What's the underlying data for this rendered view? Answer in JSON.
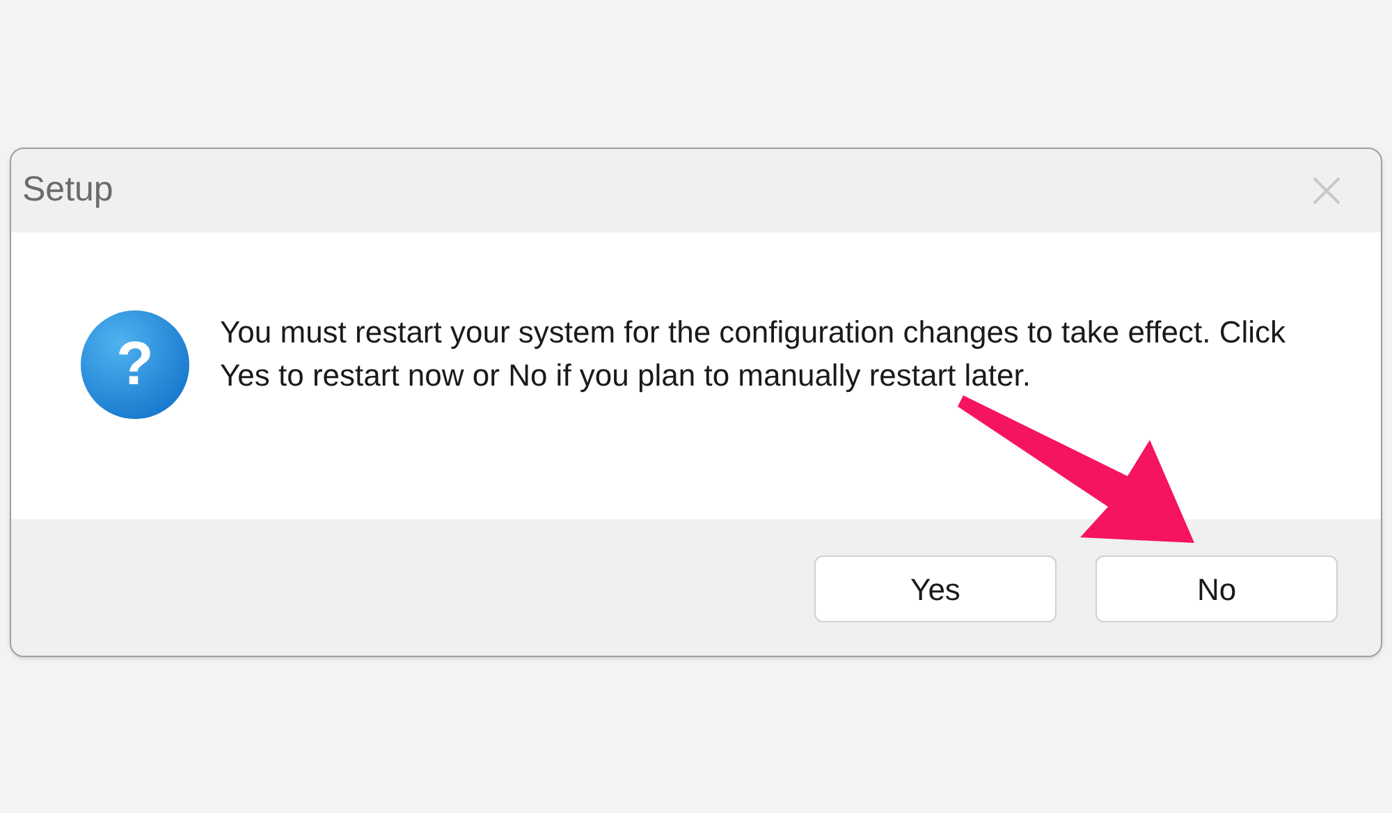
{
  "window": {
    "title": "Setup"
  },
  "dialog": {
    "icon_glyph": "?",
    "message": "You must restart your system for the configuration changes to take effect. Click Yes to restart now or No if you plan to manually restart later."
  },
  "buttons": [
    {
      "label": "Yes"
    },
    {
      "label": "No"
    }
  ]
}
